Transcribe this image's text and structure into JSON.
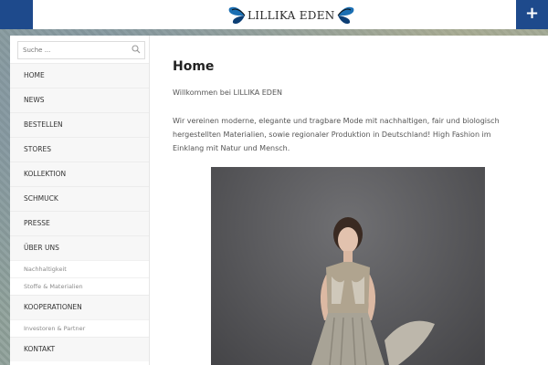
{
  "header": {
    "logo_text": "LILLIKA EDEN",
    "menu_toggle_label": "+",
    "accent_color": "#1e4a8c"
  },
  "search": {
    "placeholder": "Suche ..."
  },
  "sidebar": {
    "items": [
      {
        "label": "HOME",
        "type": "main"
      },
      {
        "label": "NEWS",
        "type": "main"
      },
      {
        "label": "BESTELLEN",
        "type": "main"
      },
      {
        "label": "STORES",
        "type": "main"
      },
      {
        "label": "KOLLEKTION",
        "type": "main"
      },
      {
        "label": "SCHMUCK",
        "type": "main"
      },
      {
        "label": "PRESSE",
        "type": "main"
      },
      {
        "label": "ÜBER UNS",
        "type": "main"
      },
      {
        "label": "Nachhaltigkeit",
        "type": "sub"
      },
      {
        "label": "Stoffe & Materialien",
        "type": "sub"
      },
      {
        "label": "KOOPERATIONEN",
        "type": "main"
      },
      {
        "label": "Investoren & Partner",
        "type": "sub"
      },
      {
        "label": "KONTAKT",
        "type": "main"
      }
    ]
  },
  "main": {
    "title": "Home",
    "welcome": "Willkommen bei LILLIKA EDEN",
    "intro": "Wir vereinen moderne, elegante und tragbare Mode mit nachhaltigen, fair und biologisch hergestellten Materialien, sowie regionaler Produktion in Deutschland! High Fashion im Einklang mit Natur und Mensch."
  },
  "icons": {
    "search": "search-icon",
    "logo": "butterfly-icon",
    "menu": "plus-icon"
  }
}
